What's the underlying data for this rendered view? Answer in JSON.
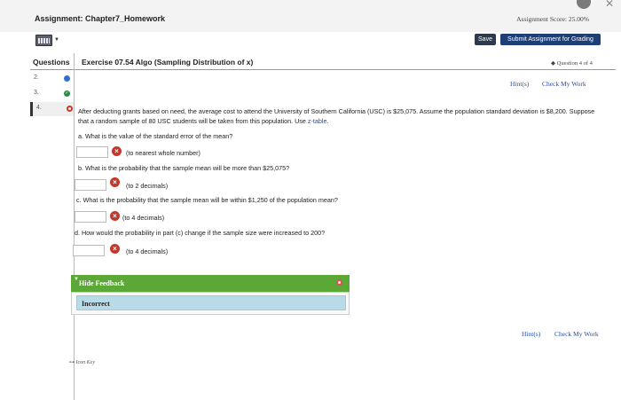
{
  "header": {
    "assignment_title": "Assignment: Chapter7_Homework",
    "score": "Assignment Score: 25.00%"
  },
  "toolbar": {
    "calculator_icon": "calculator-icon",
    "save_label": "Save",
    "submit_label": "Submit Assignment for Grading"
  },
  "questions_panel": {
    "header": "Questions",
    "items": [
      {
        "number": "2.",
        "status": "answered-blue"
      },
      {
        "number": "3.",
        "status": "correct"
      },
      {
        "number": "4.",
        "status": "incorrect",
        "active": true
      }
    ]
  },
  "exercise": {
    "title": "Exercise 07.54 Algo (Sampling Distribution of x)",
    "counter": "Question 4 of 4",
    "hint_label": "Hint(s)",
    "check_label": "Check My Work",
    "stem_text": "After deducting grants based on need, the average cost to attend the University of Southern California (USC) is $25,075. Assume the population standard deviation is $8,200. Suppose that a random sample of 80 USC students will be taken from this population. Use ",
    "stem_link": "z-table",
    "stem_end": ".",
    "parts": [
      {
        "prompt": "a. What is the value of the standard error of the mean?",
        "value": "",
        "unit": "(to nearest whole number)"
      },
      {
        "prompt": "b. What is the probability that the sample mean will be more than $25,075?",
        "value": "",
        "unit": "(to 2 decimals)"
      },
      {
        "prompt": "c. What is the probability that the sample mean will be within $1,250 of the population mean?",
        "value": "",
        "unit": "(to 4 decimals)"
      },
      {
        "prompt": "d. How would the probability in part (c) change if the sample size were increased to 200?",
        "value": "",
        "unit": "(to 4 decimals)"
      }
    ]
  },
  "feedback": {
    "toggle_label": "Hide Feedback",
    "result": "Incorrect"
  },
  "footer": {
    "hint_label": "Hint(s)",
    "check_label": "Check My Work",
    "icon_key": "Icon Key"
  },
  "colors": {
    "submit": "#1e3f76",
    "feedback_header": "#5ca836",
    "incorrect_badge": "#c0392b",
    "link": "#2b4f9e"
  }
}
